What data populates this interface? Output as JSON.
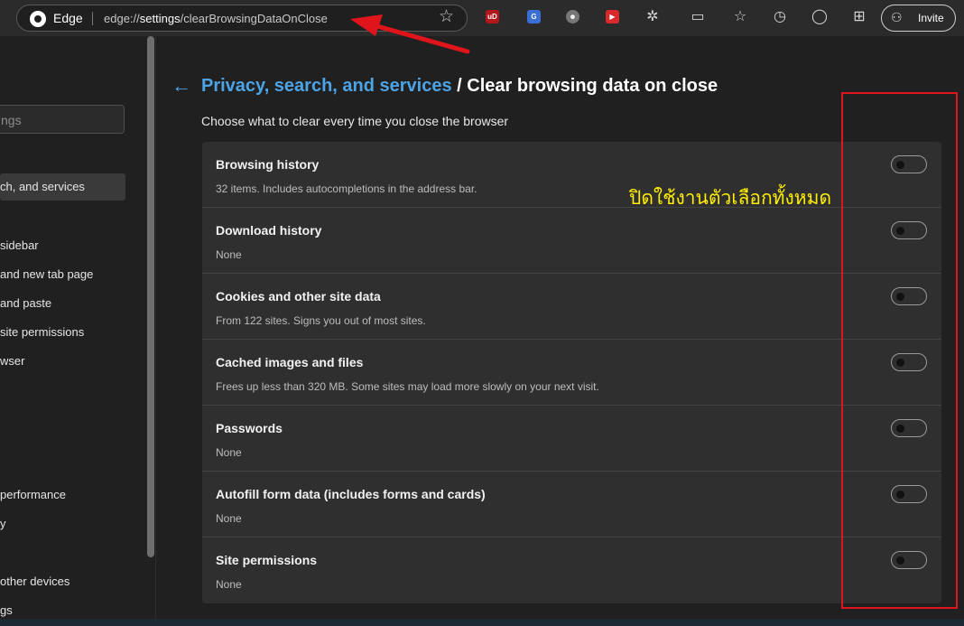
{
  "toolbar": {
    "browser_label": "Edge",
    "url_prefix": "edge://",
    "url_settings": "settings",
    "url_rest": "/clearBrowsingDataOnClose",
    "invite_label": "Invite",
    "extensions": [
      {
        "name": "ublock-icon",
        "text": "uD",
        "color": "#b3161b"
      },
      {
        "name": "translate-icon",
        "text": "G",
        "color": "#3b6fd6"
      },
      {
        "name": "robot-icon",
        "text": "☻",
        "color": "#777777"
      },
      {
        "name": "video-icon",
        "text": "▶",
        "color": "#d82a2a"
      }
    ]
  },
  "sidebar": {
    "search_placeholder": "ngs",
    "items": [
      {
        "label": "ch, and services",
        "active": true
      },
      {
        "label": "sidebar"
      },
      {
        "label": "and new tab page"
      },
      {
        "label": " and paste"
      },
      {
        "label": " site permissions"
      },
      {
        "label": "wser"
      },
      {
        "label": "performance"
      },
      {
        "label": "y"
      },
      {
        "label": "other devices"
      },
      {
        "label": "gs"
      }
    ]
  },
  "main": {
    "breadcrumb_link": "Privacy, search, and services",
    "breadcrumb_sep": "/",
    "breadcrumb_current": "Clear browsing data on close",
    "subtitle": "Choose what to clear every time you close the browser",
    "rows": [
      {
        "title": "Browsing history",
        "desc": "32 items. Includes autocompletions in the address bar.",
        "enabled": false
      },
      {
        "title": "Download history",
        "desc": "None",
        "enabled": false
      },
      {
        "title": "Cookies and other site data",
        "desc": "From 122 sites. Signs you out of most sites.",
        "enabled": false
      },
      {
        "title": "Cached images and files",
        "desc": "Frees up less than 320 MB. Some sites may load more slowly on your next visit.",
        "enabled": false
      },
      {
        "title": "Passwords",
        "desc": "None",
        "enabled": false
      },
      {
        "title": "Autofill form data (includes forms and cards)",
        "desc": "None",
        "enabled": false
      },
      {
        "title": "Site permissions",
        "desc": "None",
        "enabled": false
      }
    ]
  },
  "annotation": {
    "note": "ปิดใช้งานตัวเลือกทั้งหมด",
    "highlight_color": "#e0141b",
    "note_color": "#ffee00"
  }
}
